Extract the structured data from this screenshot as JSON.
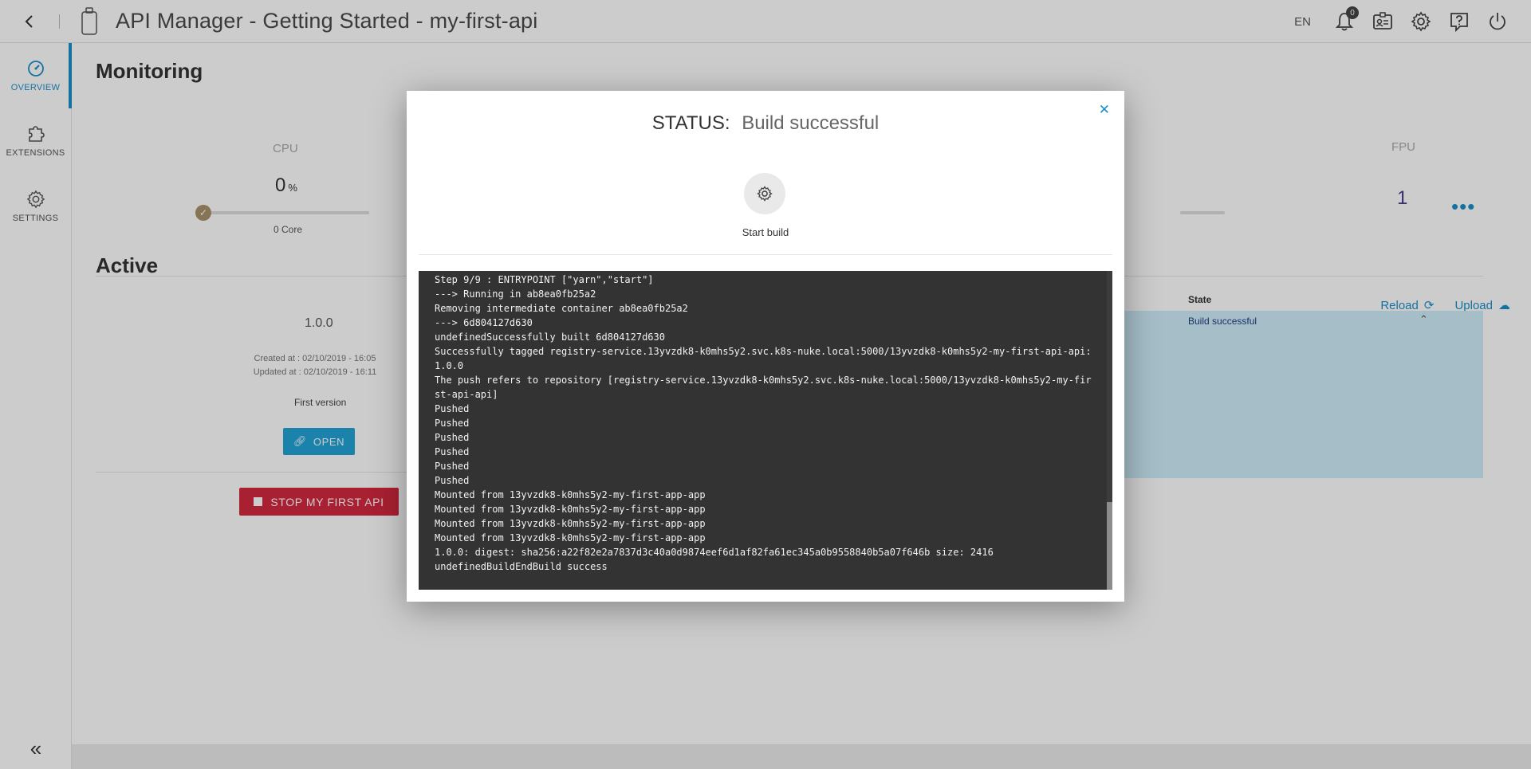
{
  "header": {
    "title": "API Manager - Getting Started - my-first-api",
    "lang": "EN",
    "notifications_count": "0"
  },
  "sidebar": {
    "items": [
      {
        "label": "OVERVIEW",
        "icon": "gauge-icon",
        "active": true
      },
      {
        "label": "EXTENSIONS",
        "icon": "puzzle-icon",
        "active": false
      },
      {
        "label": "SETTINGS",
        "icon": "gear-icon",
        "active": false
      }
    ],
    "collapse_icon": "double-chevron-left-icon"
  },
  "monitoring": {
    "title": "Monitoring",
    "cpu": {
      "label": "CPU",
      "value": "0",
      "unit": "%",
      "cores": "0 Core",
      "level": 0
    },
    "fpu": {
      "label": "FPU",
      "value": "1"
    }
  },
  "active": {
    "title": "Active",
    "version": "1.0.0",
    "created": "Created at : 02/10/2019 - 16:05",
    "updated": "Updated at : 02/10/2019 - 16:11",
    "description": "First version",
    "open_label": "OPEN",
    "stop_label": "STOP MY FIRST API",
    "reload_label": "Reload",
    "upload_label": "Upload",
    "state_header": "State",
    "state_value": "Build successful"
  },
  "modal": {
    "status_label": "STATUS:",
    "status_value": "Build successful",
    "start_build_label": "Start build",
    "log_lines": [
      "Step 9/9 : ENTRYPOINT [\"yarn\",\"start\"]",
      "---> Running in ab8ea0fb25a2",
      "Removing intermediate container ab8ea0fb25a2",
      "---> 6d804127d630",
      "undefinedSuccessfully built 6d804127d630",
      "Successfully tagged registry-service.13yvzdk8-k0mhs5y2.svc.k8s-nuke.local:5000/13yvzdk8-k0mhs5y2-my-first-api-api:1.0.0",
      "The push refers to repository [registry-service.13yvzdk8-k0mhs5y2.svc.k8s-nuke.local:5000/13yvzdk8-k0mhs5y2-my-first-api-api]",
      "Pushed",
      "Pushed",
      "Pushed",
      "Pushed",
      "Pushed",
      "Pushed",
      "Mounted from 13yvzdk8-k0mhs5y2-my-first-app-app",
      "Mounted from 13yvzdk8-k0mhs5y2-my-first-app-app",
      "Mounted from 13yvzdk8-k0mhs5y2-my-first-app-app",
      "Mounted from 13yvzdk8-k0mhs5y2-my-first-app-app",
      "1.0.0: digest: sha256:a22f82e2a7837d3c40a0d9874eef6d1af82fa61ec345a0b9558840b5a07f646b size: 2416",
      "undefinedBuildEndBuild success"
    ]
  },
  "colors": {
    "accent": "#1a8fc9",
    "danger": "#d3283e",
    "state_highlight": "#cfeefb",
    "terminal_bg": "#333333"
  }
}
